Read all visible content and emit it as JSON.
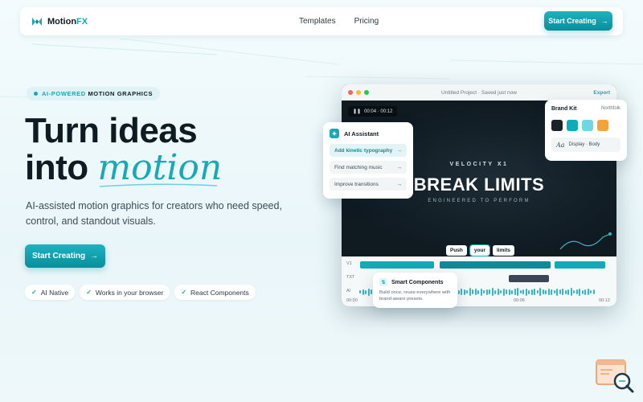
{
  "brand": {
    "name_a": "Motion",
    "name_b": "FX",
    "accent": "#17a9b6"
  },
  "nav": {
    "links": [
      "Templates",
      "Pricing"
    ],
    "cta": "Start Creating"
  },
  "hero": {
    "badge_a": "AI-POWERED ",
    "badge_b": "MOTION GRAPHICS",
    "headline_line1": "Turn ideas",
    "headline_line2a": "into ",
    "headline_line2b": "motion",
    "subtitle": "AI-assisted motion graphics for creators who need speed, control, and standout visuals.",
    "cta": "Start Creating",
    "chips": [
      "AI Native",
      "Works in your browser",
      "React Components"
    ]
  },
  "editor": {
    "title": "Untitled Project · Saved just now",
    "export": "Export",
    "timecode": "00:04 · 00:12",
    "velocity": "VELOCITY X1",
    "headline": "BREAK LIMITS",
    "tagline": "ENGINEERED TO PERFORM",
    "words": [
      "Push",
      "your",
      "limits"
    ],
    "tracks": [
      "V1",
      "TXT",
      "AI"
    ],
    "times": [
      "00:00",
      "00:06",
      "00:12"
    ]
  },
  "assistant": {
    "title": "AI Assistant",
    "items": [
      "Add kinetic typography",
      "Find matching music",
      "Improve transitions"
    ]
  },
  "brand_kit": {
    "title": "Brand Kit",
    "name": "Northfolk",
    "swatches": [
      "#1b2328",
      "#12a9b9",
      "#6fd7e3",
      "#f2a33a"
    ],
    "font_glyph": "Aa",
    "font_label": "Display · Body"
  },
  "smart": {
    "title": "Smart Components",
    "desc": "Build once, reuse everywhere with brand-aware presets."
  }
}
